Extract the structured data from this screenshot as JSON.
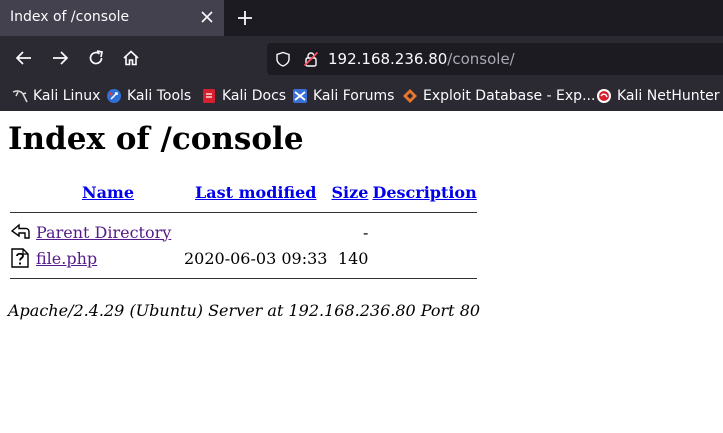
{
  "tab": {
    "title": "Index of /console"
  },
  "urlbar": {
    "host": "192.168.236.80",
    "path": "/console/"
  },
  "bookmarks": [
    {
      "label": "Kali Linux"
    },
    {
      "label": "Kali Tools"
    },
    {
      "label": "Kali Docs"
    },
    {
      "label": "Kali Forums"
    },
    {
      "label": "Exploit Database - Exp..."
    },
    {
      "label": "Kali NetHunter"
    }
  ],
  "page": {
    "heading": "Index of /console",
    "columns": {
      "name": "Name",
      "modified": "Last modified",
      "size": "Size",
      "description": "Description"
    },
    "rows": [
      {
        "name": "Parent Directory",
        "modified": "",
        "size": "-",
        "description": "",
        "icon": "back-arrow-icon"
      },
      {
        "name": "file.php",
        "modified": "2020-06-03 09:33",
        "size": "140",
        "description": "",
        "icon": "unknown-file-icon"
      }
    ],
    "footer": "Apache/2.4.29 (Ubuntu) Server at 192.168.236.80 Port 80"
  },
  "colors": {
    "link": "#0000ee",
    "visited": "#551a8b",
    "chrome_dark": "#1c1b22",
    "chrome": "#2b2a33"
  }
}
